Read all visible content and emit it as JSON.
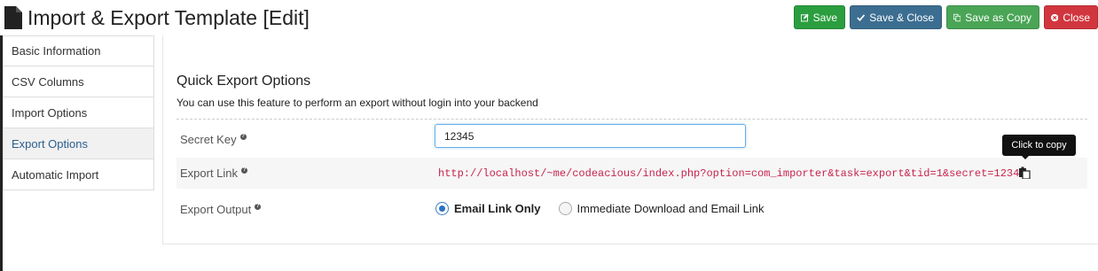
{
  "header": {
    "title": "Import & Export Template [Edit]",
    "buttons": {
      "save": "Save",
      "save_close": "Save & Close",
      "save_copy": "Save as Copy",
      "close": "Close"
    }
  },
  "sidebar": {
    "items": [
      {
        "label": "Basic Information"
      },
      {
        "label": "CSV Columns"
      },
      {
        "label": "Import Options"
      },
      {
        "label": "Export Options"
      },
      {
        "label": "Automatic Import"
      }
    ]
  },
  "main": {
    "section_title": "Quick Export Options",
    "section_desc": "You can use this feature to perform an export without login into your backend",
    "secret_key": {
      "label": "Secret Key",
      "value": "12345"
    },
    "export_link": {
      "label": "Export Link",
      "url": "http://localhost/~me/codeacious/index.php?option=com_importer&task=export&tid=1&secret=12345",
      "tooltip": "Click to copy"
    },
    "export_output": {
      "label": "Export Output",
      "options": [
        "Email Link Only",
        "Immediate Download and Email Link"
      ]
    }
  }
}
